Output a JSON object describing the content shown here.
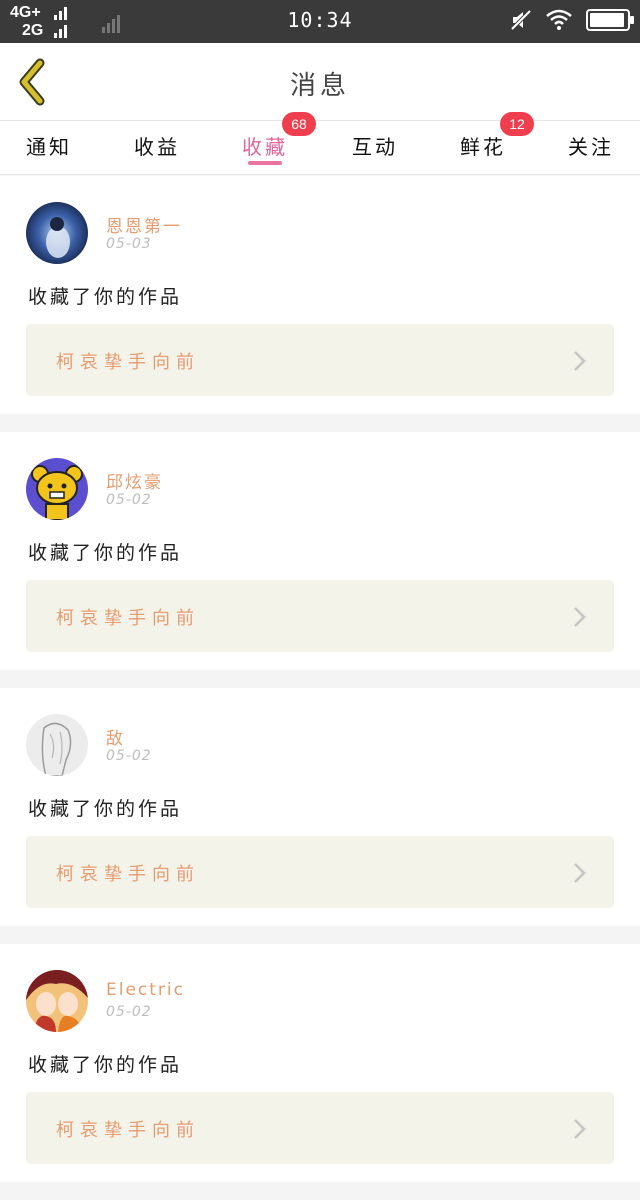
{
  "status_bar": {
    "network_top": "4G+",
    "network_bottom": "2G",
    "time": "10:34",
    "battery_level": 0.95,
    "icons": [
      "signal-bars-icon",
      "muted-icon",
      "wifi-icon",
      "battery-icon"
    ]
  },
  "header": {
    "title": "消息",
    "back_icon": "chevron-left-icon",
    "back_color": "#d4c02a"
  },
  "tabs": [
    {
      "label": "通知",
      "badge": ""
    },
    {
      "label": "收益",
      "badge": ""
    },
    {
      "label": "收藏",
      "badge": "68"
    },
    {
      "label": "互动",
      "badge": ""
    },
    {
      "label": "鲜花",
      "badge": "12"
    },
    {
      "label": "关注",
      "badge": ""
    }
  ],
  "active_tab": "收藏",
  "colors": {
    "accent": "#e0649a",
    "badge": "#ef3f4f",
    "username": "#e59c6f",
    "card_inner": "#f3f3ea"
  },
  "feed": [
    {
      "user": "恩恩第一",
      "date": "05-03",
      "action": "收藏了你的作品",
      "work": "柯哀挚手向前",
      "avatar": "avatar-dark-blue"
    },
    {
      "user": "邱炫豪",
      "date": "05-02",
      "action": "收藏了你的作品",
      "work": "柯哀挚手向前",
      "avatar": "avatar-yellow-bear"
    },
    {
      "user": "敌",
      "date": "05-02",
      "action": "收藏了你的作品",
      "work": "柯哀挚手向前",
      "avatar": "avatar-sketch"
    },
    {
      "user": "Electric",
      "date": "05-02",
      "action": "收藏了你的作品",
      "work": "柯哀挚手向前",
      "avatar": "avatar-anime"
    }
  ]
}
